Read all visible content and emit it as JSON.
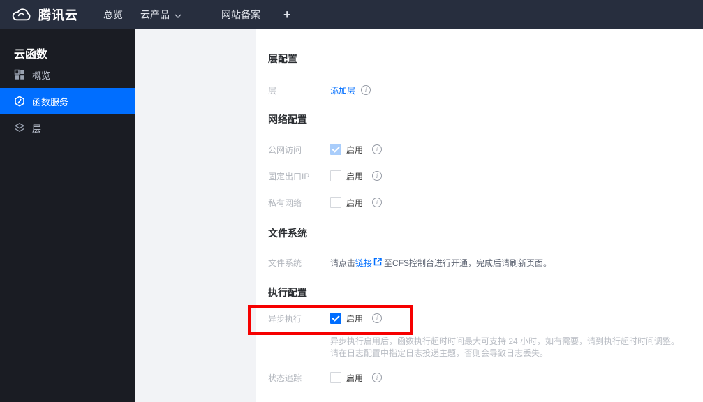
{
  "topbar": {
    "brand": "腾讯云",
    "overview": "总览",
    "products": "云产品",
    "icp": "网站备案",
    "plus": "+"
  },
  "sidebar": {
    "title": "云函数",
    "overview": "概览",
    "functions": "函数服务",
    "layers": "层"
  },
  "sections": {
    "layer": {
      "heading": "层配置",
      "row_label": "层",
      "add_link": "添加层"
    },
    "network": {
      "heading": "网络配置",
      "rows": [
        {
          "label": "公网访问",
          "value": "启用",
          "checked": true,
          "disabled": true
        },
        {
          "label": "固定出口IP",
          "value": "启用",
          "checked": false,
          "disabled": true
        },
        {
          "label": "私有网络",
          "value": "启用",
          "checked": false,
          "disabled": true
        }
      ]
    },
    "filesystem": {
      "heading": "文件系统",
      "row_label": "文件系统",
      "text_before": "请点击",
      "link": "链接",
      "text_after": "至CFS控制台进行开通，完成后请刷新页面。"
    },
    "execution": {
      "heading": "执行配置",
      "async_row": {
        "label": "异步执行",
        "value": "启用",
        "checked": true,
        "description_line1": "异步执行启用后，函数执行超时时间最大可支持 24 小时，如有需要，请到执行超时时间调整。",
        "description_line2": "请在日志配置中指定日志投递主题，否则会导致日志丢失。"
      },
      "trace_row": {
        "label": "状态追踪",
        "value": "启用",
        "checked": false
      }
    }
  },
  "icons": {
    "info_glyph": "i",
    "logo": "tencent-cloud",
    "external_link": "open-in-new"
  },
  "colors": {
    "accent_blue": "#006eff",
    "annotation_red": "#f60000",
    "topbar_bg": "#272e3e",
    "sidebar_bg": "#1a1c23",
    "panel_gray": "#f2f3f6",
    "disabled_check_bg": "#a9cdfb"
  }
}
